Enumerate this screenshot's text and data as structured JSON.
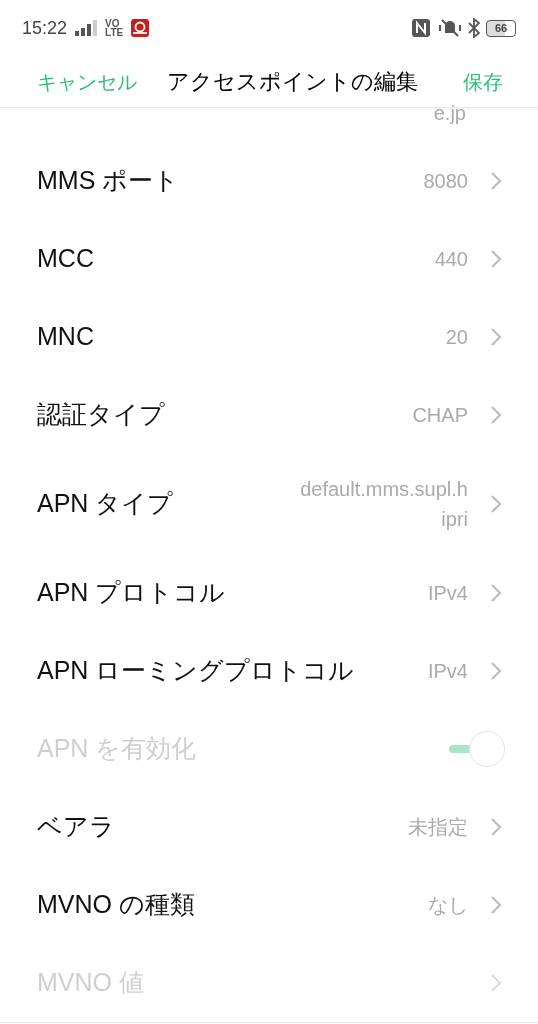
{
  "status_bar": {
    "time": "15:22",
    "network_top": "VO",
    "network_bottom": "LTE",
    "battery": "66"
  },
  "header": {
    "cancel": "キャンセル",
    "title": "アクセスポイントの編集",
    "save": "保存"
  },
  "partial_value": "e.jp",
  "rows": [
    {
      "kind": "value",
      "label": "MMS ポート",
      "value": "8080",
      "disabled": false
    },
    {
      "kind": "value",
      "label": "MCC",
      "value": "440",
      "disabled": false
    },
    {
      "kind": "value",
      "label": "MNC",
      "value": "20",
      "disabled": false
    },
    {
      "kind": "value",
      "label": "認証タイプ",
      "value": "CHAP",
      "disabled": false
    },
    {
      "kind": "value",
      "label": "APN タイプ",
      "value": "default.mms.supl.h ipri",
      "disabled": false
    },
    {
      "kind": "value",
      "label": "APN プロトコル",
      "value": "IPv4",
      "disabled": false
    },
    {
      "kind": "value",
      "label": "APN ローミングプロトコル",
      "value": "IPv4",
      "disabled": false
    },
    {
      "kind": "toggle",
      "label": "APN を有効化",
      "on": true,
      "disabled": true
    },
    {
      "kind": "value",
      "label": "ベアラ",
      "value": "未指定",
      "disabled": false
    },
    {
      "kind": "value",
      "label": "MVNO の種類",
      "value": "なし",
      "disabled": false
    },
    {
      "kind": "value",
      "label": "MVNO 値",
      "disabled": true
    }
  ]
}
